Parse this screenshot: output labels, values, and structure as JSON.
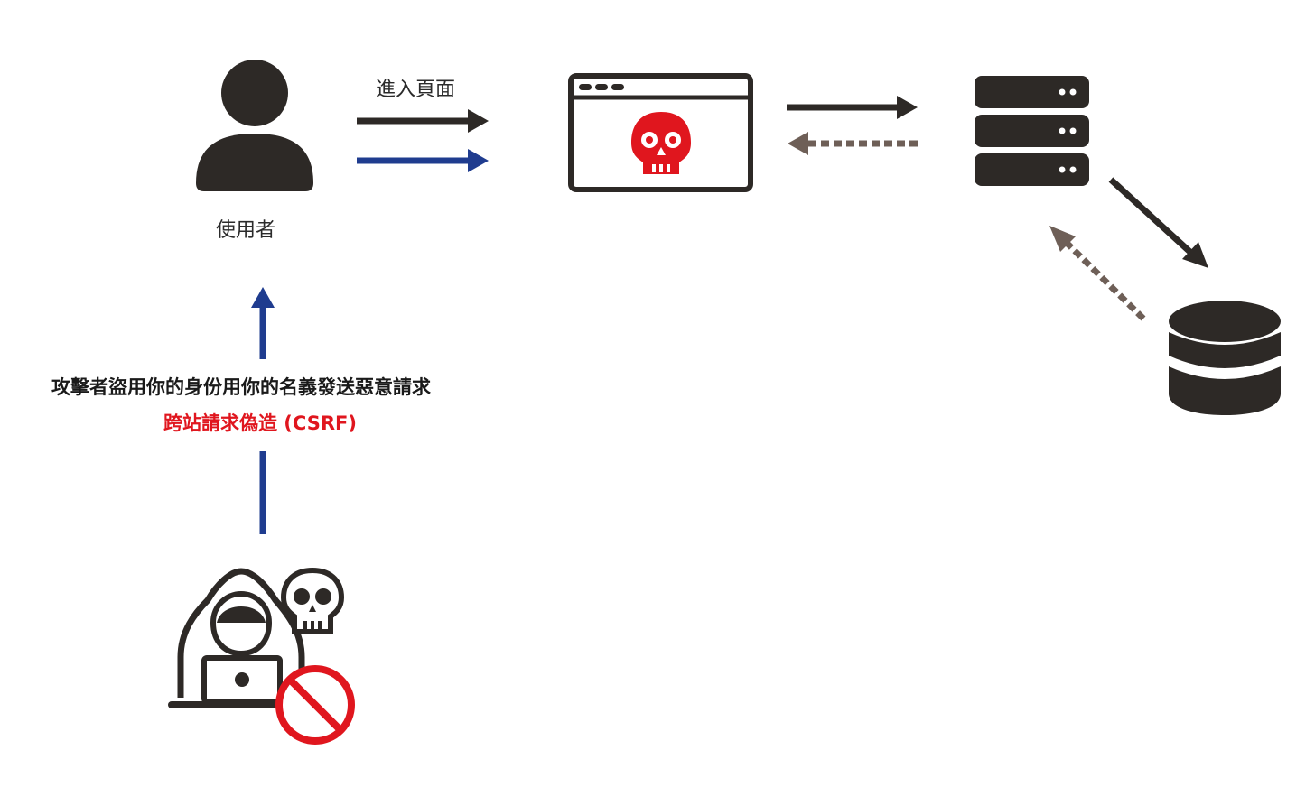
{
  "labels": {
    "user": "使用者",
    "enter_page": "進入頁面",
    "attack_description": "攻擊者盜用你的身份用你的名義發送惡意請求",
    "csrf": "跨站請求偽造 (CSRF)"
  },
  "colors": {
    "dark": "#2d2926",
    "blue": "#1f3c8f",
    "red": "#e0161e",
    "brown": "#6e5f57"
  },
  "icons": {
    "user": "user-icon",
    "browser": "malicious-browser-icon",
    "server": "server-icon",
    "database": "database-icon",
    "attacker": "hacker-icon",
    "skull": "skull-icon",
    "prohibited": "prohibited-icon"
  }
}
